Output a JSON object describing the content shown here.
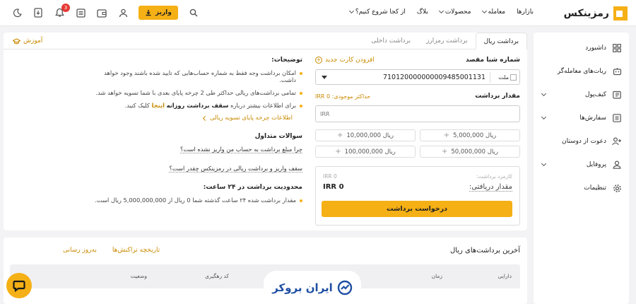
{
  "header": {
    "logo_text": "رمزینکس",
    "nav": [
      {
        "label": "بازارها",
        "dropdown": false
      },
      {
        "label": "معامله",
        "dropdown": true
      },
      {
        "label": "محصولات",
        "dropdown": true
      },
      {
        "label": "بلاگ",
        "dropdown": false
      },
      {
        "label": "از کجا شروع کنیم؟",
        "dropdown": true
      }
    ],
    "deposit_label": "واریز",
    "notification_count": "3"
  },
  "sidebar": {
    "items": [
      {
        "label": "داشبورد",
        "icon": "grid-icon",
        "dropdown": false
      },
      {
        "label": "ربات‌های معامله‌گر",
        "icon": "robot-icon",
        "dropdown": false
      },
      {
        "label": "کیف‌پول",
        "icon": "wallet-icon",
        "dropdown": true
      },
      {
        "label": "سفارش‌ها",
        "icon": "orders-icon",
        "dropdown": true
      },
      {
        "label": "دعوت از دوستان",
        "icon": "add-user-icon",
        "dropdown": false
      },
      {
        "label": "پروفایل",
        "icon": "user-icon",
        "dropdown": true
      },
      {
        "label": "تنظیمات",
        "icon": "gear-icon",
        "dropdown": false
      }
    ]
  },
  "tabs": [
    {
      "label": "برداشت ریال",
      "active": true
    },
    {
      "label": "برداشت رمزارز",
      "active": false
    },
    {
      "label": "برداشت داخلی",
      "active": false
    }
  ],
  "learn_label": "آموزش",
  "form": {
    "iban_label": "شماره شبا مقصد",
    "add_card_label": "افزودن کارت جدید",
    "bank_name": "ملت",
    "iban_value": "710120000000009485001131",
    "amount_label": "مقدار برداشت",
    "max_label": "حداکثر موجودی: IRR 0",
    "currency": "IRR",
    "quick_amounts": [
      "5,000,000 ریال",
      "10,000,000 ریال",
      "50,000,000 ریال",
      "100,000,000 ریال"
    ],
    "fee_label": "کارمزد برداشت:",
    "fee_value": "IRR 0",
    "receive_label": "مقدار دریافتی:",
    "receive_value": "IRR 0",
    "submit_label": "درخواست برداشت"
  },
  "info": {
    "notes_title": "توضیحات:",
    "notes": [
      "امکان برداشت وجه فقط به شماره حساب‌هایی که تایید شده باشند وجود خواهد داشت.",
      "تمامی برداشت‌های ریالی حداکثر طی 2 چرخه پایای بعدی با شما تسویه خواهد شد."
    ],
    "note3_prefix": "برای اطلاعات بیشتر درباره",
    "note3_bold": "سقف برداشت روزانه",
    "note3_link": "اینجا",
    "note3_suffix": "کلیک کنید.",
    "paya_link": "اطلاعات چرخه پایای تسویه ریالی",
    "faq_title": "سوالات متداول",
    "faq": [
      "چرا مبلغ برداشت به حساب من واریز نشده است؟",
      "سقف واریز و برداشت ریالی در رمزینکس چقدر است؟"
    ],
    "limit_title": "محدودیت برداشت در ۲۴ ساعت:",
    "limit_text": "مقدار برداشت شده ۲۴ ساعت گذشته شما 0 ریال از 5,000,000,000 ریال است."
  },
  "history": {
    "title": "آخرین برداشت‌های ریال",
    "refresh_label": "به‌روز رسانی",
    "history_label": "تاریخچه تراکنش‌ها",
    "columns": [
      "دارایی",
      "زمان",
      "کد رهگیری",
      "وضعیت"
    ]
  },
  "watermark": "ایران بروکر",
  "colors": {
    "accent": "#f5b015",
    "accent_text": "#c98a00",
    "brand_blue": "#1f4fa3"
  }
}
